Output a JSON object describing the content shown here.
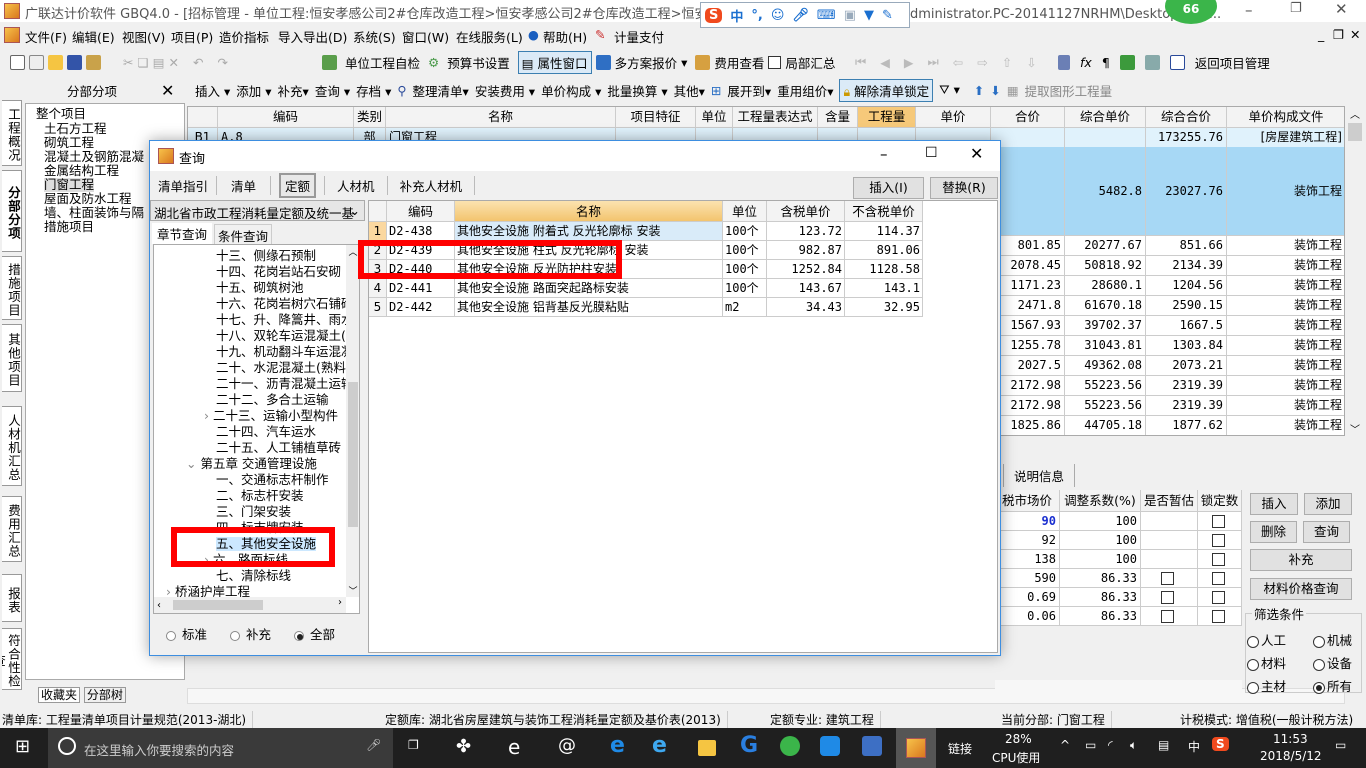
{
  "titlebar": {
    "title": "广联达计价软件 GBQ4.0 - [招标管理 - 单位工程:恒安孝感公司2#仓库改造工程>恒安孝感公司2#仓库改造工程>恒安孝感公司2",
    "path_tail": "dministrator.PC-20141127NRHM\\Desktop\\恒安...",
    "badge": "66"
  },
  "ime": {
    "mode": "中",
    "punct": "°,"
  },
  "menu": [
    "文件(F)",
    "编辑(E)",
    "视图(V)",
    "项目(P)",
    "造价指标",
    "导入导出(D)",
    "系统(S)",
    "窗口(W)",
    "在线服务(L)",
    "帮助(H)",
    "计量支付"
  ],
  "toolbar1": {
    "self_check": "单位工程自检",
    "budget_settings": "预算书设置",
    "property_window": "属性窗口",
    "multi_quote": "多方案报价",
    "fee_view": "费用查看",
    "partial_summary": "局部汇总",
    "return_project": "返回项目管理"
  },
  "toolbar2": {
    "panel_title": "分部分项",
    "insert": "插入",
    "add": "添加",
    "supplement": "补充",
    "query": "查询",
    "archive": "存档",
    "organize": "整理清单",
    "install_fee": "安装费用",
    "unit_price": "单价构成",
    "batch_convert": "批量换算",
    "other": "其他",
    "expand": "展开到",
    "reuse": "重用组价",
    "unlock": "解除清单锁定",
    "extract": "提取图形工程量"
  },
  "vtabs": [
    "工程概况",
    "分部分项",
    "措施项目",
    "其他项目",
    "人材机汇总",
    "费用汇总",
    "报表",
    "符合性检查"
  ],
  "tree": {
    "root": "整个项目",
    "items": [
      "土石方工程",
      "砌筑工程",
      "混凝土及钢筋混凝",
      "金属结构工程",
      "门窗工程",
      "屋面及防水工程",
      "墙、柱面装饰与隔",
      "措施项目"
    ],
    "bottom_tabs": [
      "收藏夹",
      "分部树"
    ]
  },
  "grid": {
    "headers": [
      "编码",
      "类别",
      "名称",
      "项目特征",
      "单位",
      "工程量表达式",
      "含量",
      "工程量",
      "单价",
      "合价",
      "综合单价",
      "综合合价",
      "单价构成文件"
    ],
    "b1": {
      "num": "B1",
      "code": "A.8",
      "type": "部",
      "name": "门窗工程",
      "total": "173255.76",
      "file": "[房屋建筑工程]"
    },
    "selected": {
      "unit_comp": "5482.8",
      "total_comp": "23027.76",
      "file": "装饰工程"
    },
    "rows": [
      [
        "801.85",
        "20277.67",
        "851.66",
        "装饰工程"
      ],
      [
        "2078.45",
        "50818.92",
        "2134.39",
        "装饰工程"
      ],
      [
        "1171.23",
        "28680.1",
        "1204.56",
        "装饰工程"
      ],
      [
        "2471.8",
        "61670.18",
        "2590.15",
        "装饰工程"
      ],
      [
        "1567.93",
        "39702.37",
        "1667.5",
        "装饰工程"
      ],
      [
        "1255.78",
        "31043.81",
        "1303.84",
        "装饰工程"
      ],
      [
        "2027.5",
        "49362.08",
        "2073.21",
        "装饰工程"
      ],
      [
        "2172.98",
        "55223.56",
        "2319.39",
        "装饰工程"
      ],
      [
        "2172.98",
        "55223.56",
        "2319.39",
        "装饰工程"
      ],
      [
        "1825.86",
        "44705.18",
        "1877.62",
        "装饰工程"
      ]
    ]
  },
  "bottom": {
    "tab": "说明信息",
    "headers": [
      "税市场价",
      "调整系数(%)",
      "是否暂估",
      "锁定数"
    ],
    "rows": [
      {
        "price": "90",
        "coef": "100",
        "est": false,
        "lock": false
      },
      {
        "price": "92",
        "coef": "100",
        "est": false,
        "lock": false
      },
      {
        "price": "138",
        "coef": "100",
        "est": false,
        "lock": false
      },
      {
        "price": "590",
        "coef": "86.33",
        "est": true,
        "lock": false
      },
      {
        "price": "0.69",
        "coef": "86.33",
        "est": true,
        "lock": false
      },
      {
        "price": "0.06",
        "coef": "86.33",
        "est": true,
        "lock": false
      }
    ],
    "buttons": {
      "insert": "插入",
      "add": "添加",
      "delete": "删除",
      "query": "查询",
      "supplement": "补充",
      "material_query": "材料价格查询"
    },
    "filter": {
      "title": "筛选条件",
      "options": [
        "人工",
        "机械",
        "材料",
        "设备",
        "主材",
        "所有"
      ],
      "selected": "所有"
    }
  },
  "dialog": {
    "title": "查询",
    "tabs": [
      "清单指引",
      "清单",
      "定额",
      "人材机",
      "补充人材机"
    ],
    "active_tab": "定额",
    "insert": "插入(I)",
    "replace": "替换(R)",
    "library": "湖北省市政工程消耗量定额及统一基",
    "subtabs": [
      "章节查询",
      "条件查询"
    ],
    "tree": [
      "十三、侧缘石预制",
      "十四、花岗岩站石安砌",
      "十五、砌筑树池",
      "十六、花岗岩树穴石铺砌",
      "十七、升、降篙井、雨水",
      "十八、双轮车运混凝土(",
      "十九、机动翻斗车运混凝",
      "二十、水泥混凝土(熟料",
      "二十一、沥青混凝土运输",
      "二十二、多合土运输",
      "二十三、运输小型构件",
      "二十四、汽车运水",
      "二十五、人工铺植草砖",
      "第五章 交通管理设施",
      "一、交通标志杆制作",
      "二、标志杆安装",
      "三、门架安装",
      "四、标志牌安装",
      "五、其他安全设施",
      "六、路面标线",
      "七、清除标线",
      "桥涵护岸工程"
    ],
    "radios": [
      "标准",
      "补充",
      "全部"
    ],
    "radio_selected": "全部",
    "table_headers": [
      "编码",
      "名称",
      "单位",
      "含税单价",
      "不含税单价"
    ],
    "rows": [
      {
        "n": "1",
        "code": "D2-438",
        "name": "其他安全设施 附着式 反光轮廓标 安装",
        "unit": "100个",
        "tax": "123.72",
        "notax": "114.37"
      },
      {
        "n": "2",
        "code": "D2-439",
        "name": "其他安全设施 柱式 反光轮廓标 安装",
        "unit": "100个",
        "tax": "982.87",
        "notax": "891.06"
      },
      {
        "n": "3",
        "code": "D2-440",
        "name": "其他安全设施 反光防护柱安装",
        "unit": "100个",
        "tax": "1252.84",
        "notax": "1128.58"
      },
      {
        "n": "4",
        "code": "D2-441",
        "name": "其他安全设施 路面突起路标安装",
        "unit": "100个",
        "tax": "143.67",
        "notax": "143.1"
      },
      {
        "n": "5",
        "code": "D2-442",
        "name": "其他安全设施 铝背基反光膜粘贴",
        "unit": "m2",
        "tax": "34.43",
        "notax": "32.95"
      }
    ]
  },
  "status": {
    "list_lib": "清单库: 工程量清单项目计量规范(2013-湖北)",
    "quota_lib": "定额库: 湖北省房屋建筑与装饰工程消耗量定额及基价表(2013)",
    "quota_major": "定额专业: 建筑工程",
    "current_part": "当前分部: 门窗工程",
    "tax_mode": "计税模式: 增值税(一般计税方法)"
  },
  "taskbar": {
    "search_placeholder": "在这里输入你要搜索的内容",
    "link": "链接",
    "cpu_pct": "28%",
    "cpu_label": "CPU使用",
    "ime": "中",
    "time": "11:53",
    "date": "2018/5/12"
  },
  "colors": {
    "selected_row": "#a7d8f5",
    "header_highlight": "#f6c97a",
    "red_box": "#ff0000",
    "dialog_border": "#3d8ee0"
  }
}
